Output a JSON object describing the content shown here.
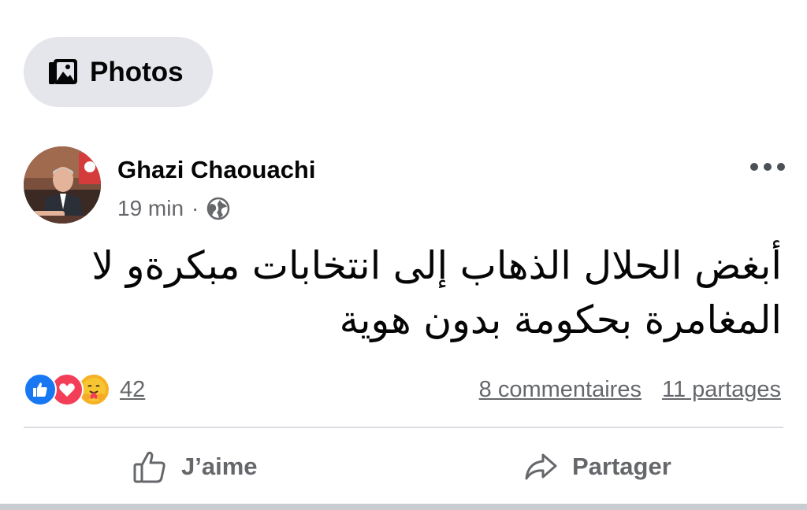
{
  "filter_chip": {
    "label": "Photos",
    "icon": "photos-icon"
  },
  "post": {
    "author": "Ghazi Chaouachi",
    "time": "19 min",
    "separator": "·",
    "audience_icon": "globe-icon",
    "text_lines": [
      "أبغض الحلال الذهاب إلى انتخابات مبكرةو لا",
      "المغامرة بحكومة بدون هوية"
    ]
  },
  "stats": {
    "reactions": [
      "like",
      "love",
      "care"
    ],
    "reaction_count": "42",
    "comments": "8 commentaires",
    "shares": "11 partages"
  },
  "actions": {
    "like_label": "J’aime",
    "share_label": "Partager"
  },
  "colors": {
    "chip_bg": "#e4e6eb",
    "secondary_text": "#65676b",
    "like_blue": "#1877f2",
    "love_red": "#f33e58",
    "care_yellow": "#f7b125"
  }
}
